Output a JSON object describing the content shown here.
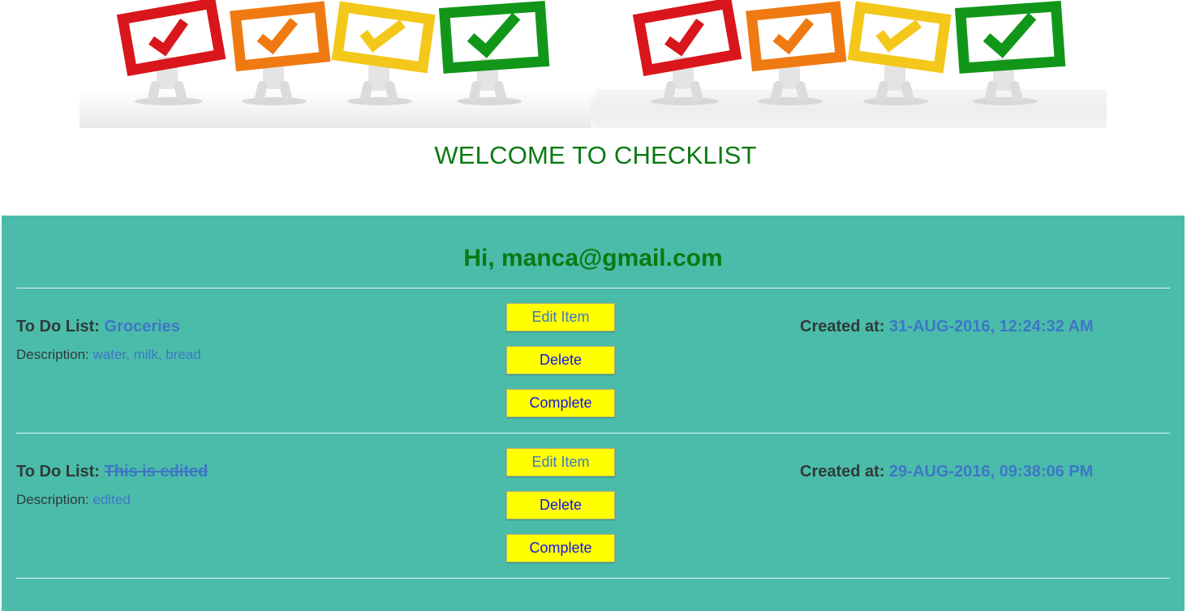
{
  "header": {
    "welcome": "WELCOME TO CHECKLIST",
    "banner_icon": "checkbox-figures-banner",
    "colors": {
      "welcome": "#0a7a12",
      "panel_background": "#4bbcaa",
      "button_background": "#ffff00",
      "link_text": "#3d77c6",
      "button_text": "#1414e6"
    }
  },
  "greeting": "Hi, manca@gmail.com",
  "items": [
    {
      "list_label": "To Do List:",
      "list_value": "Groceries",
      "completed": false,
      "description_label": "Description:",
      "description_value": "water, milk, bread",
      "buttons": {
        "edit": "Edit Item",
        "delete": "Delete",
        "complete": "Complete"
      },
      "created_label": "Created at:",
      "created_value": "31-AUG-2016, 12:24:32 AM"
    },
    {
      "list_label": "To Do List:",
      "list_value": "This is edited",
      "completed": true,
      "description_label": "Description:",
      "description_value": "edited",
      "buttons": {
        "edit": "Edit Item",
        "delete": "Delete",
        "complete": "Complete"
      },
      "created_label": "Created at:",
      "created_value": "29-AUG-2016, 09:38:06 PM"
    }
  ]
}
